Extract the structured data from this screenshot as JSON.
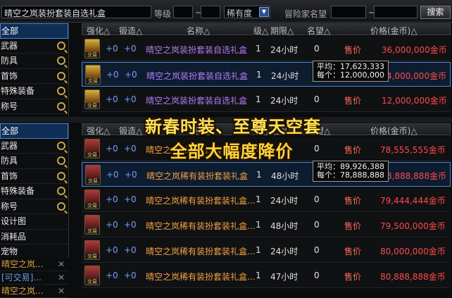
{
  "topbar": {
    "search_value": "晴空之岚装扮套装自选礼盒",
    "level_label": "等级",
    "level_separator": "~",
    "rarity_label": "稀有度",
    "adventurer_label": "冒险家名望",
    "adventurer_separator": "~",
    "search_button": "搜索"
  },
  "categories_top": [
    {
      "label": "全部",
      "active": true
    },
    {
      "label": "武器"
    },
    {
      "label": "防具"
    },
    {
      "label": "首饰"
    },
    {
      "label": "特殊装备"
    },
    {
      "label": "称号"
    }
  ],
  "categories_bottom": [
    {
      "label": "全部",
      "active": true
    },
    {
      "label": "武器"
    },
    {
      "label": "防具"
    },
    {
      "label": "首饰"
    },
    {
      "label": "特殊装备"
    },
    {
      "label": "称号"
    },
    {
      "label": "设计图"
    },
    {
      "label": "消耗品"
    },
    {
      "label": "宠物"
    }
  ],
  "saved_searches": [
    {
      "label": "晴空之岚...",
      "color": "orange"
    },
    {
      "label": "[可交易]...",
      "color": "blue"
    },
    {
      "label": "晴空之岚...",
      "color": "orange"
    }
  ],
  "table_header": {
    "enhance": "强化△",
    "forge": "锻造△",
    "name": "名称△",
    "level": "级△",
    "period": "期限△",
    "fame": "名望△",
    "price": "价格(金币)△"
  },
  "icon_tag": "交易",
  "table_top": [
    {
      "enhance": "+0",
      "forge": "+0",
      "name": "晴空之岚装扮套装自选礼盒",
      "level": "1",
      "period": "24小时",
      "fame": "0",
      "sell": "售价",
      "price": "36,000,000金币"
    },
    {
      "enhance": "+0",
      "forge": "+0",
      "name": "晴空之岚装扮套装自选礼盒",
      "level": "1",
      "period": "24小时",
      "fame": "0",
      "sell": "售价",
      "price": "4,000,000金币"
    },
    {
      "enhance": "+0",
      "forge": "+0",
      "name": "晴空之岚装扮套装自选礼盒",
      "level": "1",
      "period": "24小时",
      "fame": "0",
      "sell": "售价",
      "price": "12,000,000金币"
    }
  ],
  "tooltip_top": {
    "avg": "平均：17,623,333",
    "each": "每个：12,000,000"
  },
  "table_bottom": [
    {
      "enhance": "+0",
      "forge": "+0",
      "name": "晴空之岚稀有装扮套装礼盒",
      "level": "1",
      "period": "",
      "fame": "0",
      "sell": "售价",
      "price": "78,555,555金币"
    },
    {
      "enhance": "+0",
      "forge": "+0",
      "name": "晴空之岚稀有装扮套装礼盒",
      "level": "1",
      "period": "48小时",
      "fame": "0",
      "sell": "售价",
      "price": "8,888,888金币"
    },
    {
      "enhance": "+0",
      "forge": "+0",
      "name": "晴空之岚稀有装扮套装礼盒...",
      "level": "1",
      "period": "24小时",
      "fame": "0",
      "sell": "售价",
      "price": "79,444,444金币"
    },
    {
      "enhance": "+0",
      "forge": "+0",
      "name": "晴空之岚稀有装扮套装礼盒...",
      "level": "1",
      "period": "48小时",
      "fame": "0",
      "sell": "售价",
      "price": "79,500,000金币"
    },
    {
      "enhance": "+0",
      "forge": "+0",
      "name": "晴空之岚稀有装扮套装礼盒...",
      "level": "1",
      "period": "24小时",
      "fame": "0",
      "sell": "售价",
      "price": "80,000,000金币"
    },
    {
      "enhance": "+0",
      "forge": "+0",
      "name": "晴空之岚稀有装扮套装礼盒...",
      "level": "1",
      "period": "47小时",
      "fame": "0",
      "sell": "售价",
      "price": "80,888,888金币"
    }
  ],
  "tooltip_bottom": {
    "avg": "平均：89,926,388",
    "each": "每个：78,888,888"
  },
  "promo": {
    "line1": "新春时装、至尊天空套",
    "line2": "全部大幅度降价"
  }
}
